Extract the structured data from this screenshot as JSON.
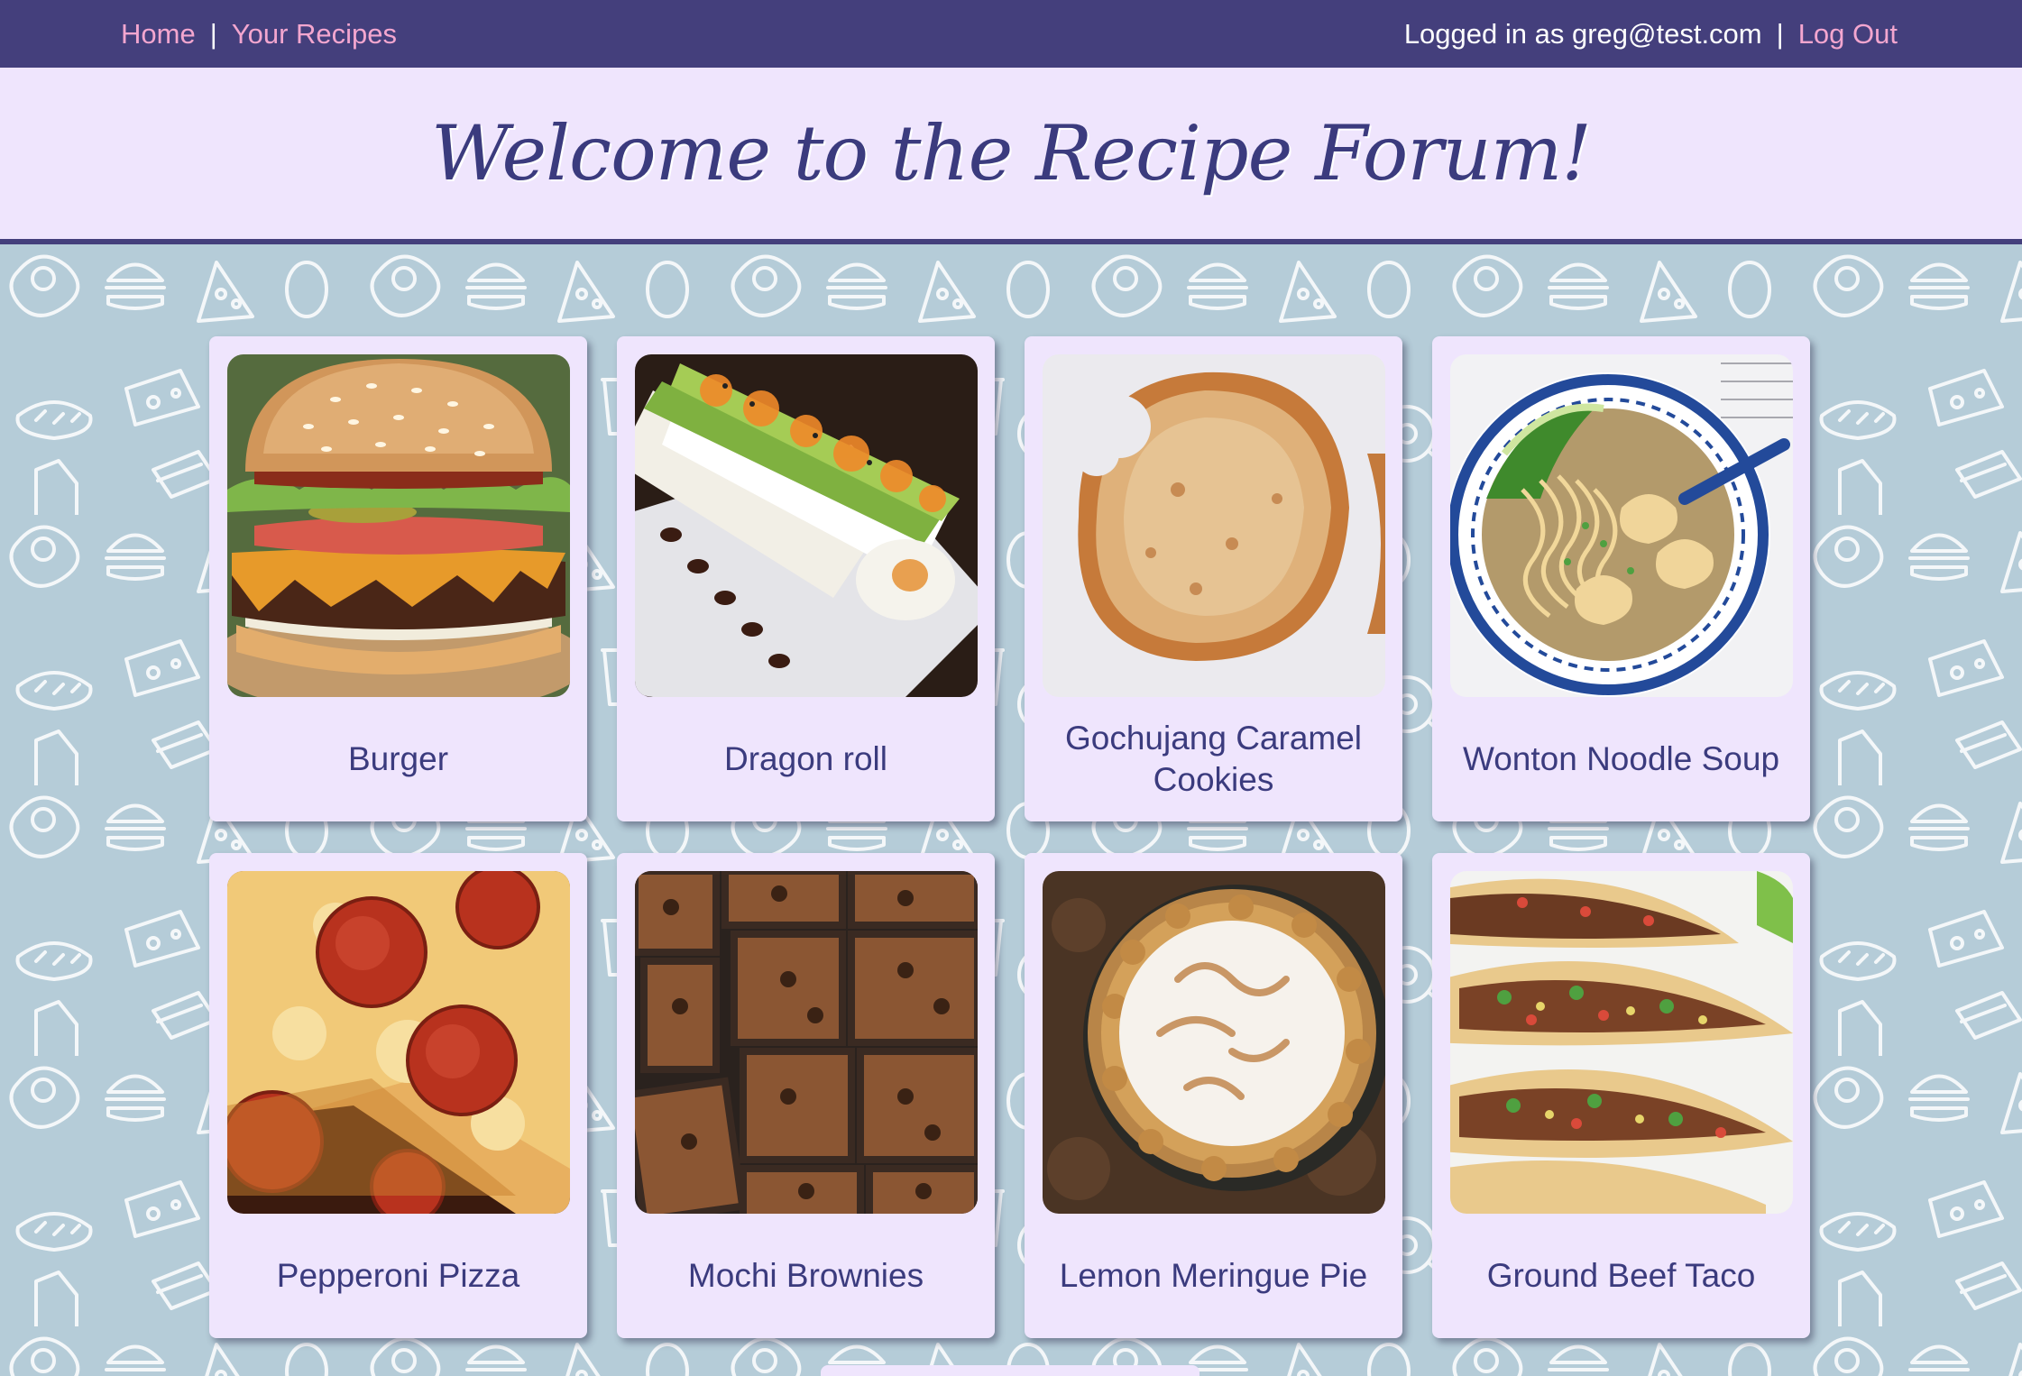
{
  "nav": {
    "home": "Home",
    "separator": "|",
    "your_recipes": "Your Recipes",
    "logged_in_text": "Logged in as greg@test.com",
    "logout": "Log Out"
  },
  "banner": {
    "title": "Welcome to the Recipe Forum!"
  },
  "colors": {
    "nav_bg": "#443f7c",
    "nav_link": "#f3a6cf",
    "banner_bg": "#efe5fd",
    "title_text": "#3b3b7e",
    "page_bg": "#b5ccd8",
    "card_bg": "#efe5fd"
  },
  "recipes": [
    {
      "name": "Burger",
      "image": "burger-photo"
    },
    {
      "name": "Dragon roll",
      "image": "sushi-roll-photo"
    },
    {
      "name": "Gochujang Caramel Cookies",
      "image": "cookie-photo"
    },
    {
      "name": "Wonton Noodle Soup",
      "image": "soup-photo"
    },
    {
      "name": "Pepperoni Pizza",
      "image": "pizza-photo"
    },
    {
      "name": "Mochi Brownies",
      "image": "brownie-photo"
    },
    {
      "name": "Lemon Meringue Pie",
      "image": "pie-photo"
    },
    {
      "name": "Ground Beef Taco",
      "image": "taco-photo"
    }
  ]
}
